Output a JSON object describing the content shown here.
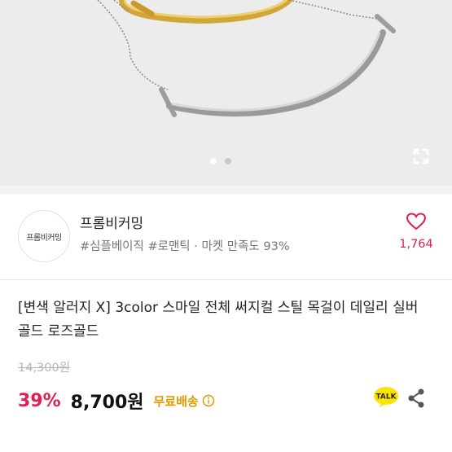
{
  "hero": {
    "icon": "expand-icon",
    "pagination_total": 2,
    "pagination_active": 1
  },
  "seller": {
    "avatar_text": "프롬비커밍",
    "name": "프롬비커밍",
    "tags": "#심플베이직 #로맨틱 · 마켓 만족도 93%",
    "like_count": "1,764",
    "like_icon": "heart-icon"
  },
  "product": {
    "title": "[변색 알러지 X] 3color 스마일 전체 써지컬 스틸 목걸이 데일리 실버 골드 로즈골드",
    "original_price": "14,300원",
    "discount": "39%",
    "price": "8,700원",
    "shipping": "무료배송"
  },
  "actions": {
    "talk_label": "TALK",
    "share_icon": "share-icon",
    "info_icon": "info-icon"
  },
  "colors": {
    "accent": "#e0204f",
    "shipping": "#e09a00",
    "kakao_yellow": "#f7e600"
  }
}
